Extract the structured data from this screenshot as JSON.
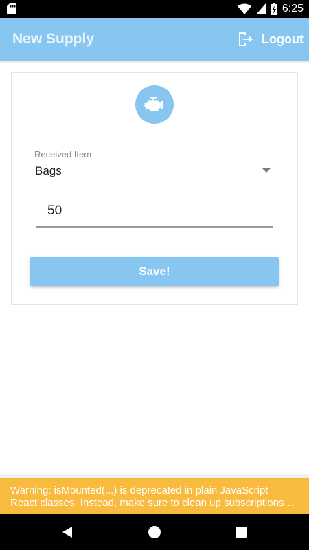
{
  "status_bar": {
    "time": "6:25",
    "icons": [
      "sd-card-icon",
      "wifi-icon",
      "cellular-signal-icon",
      "battery-charging-icon"
    ]
  },
  "app_bar": {
    "title": "New Supply",
    "logout_label": "Logout",
    "logout_icon": "logout-icon",
    "background_color": "#86c6f0"
  },
  "form": {
    "icon": "engine-icon",
    "received_item": {
      "label": "Received Item",
      "selected_value": "Bags"
    },
    "quantity": {
      "value": "50"
    },
    "save_label": "Save!"
  },
  "warning": {
    "line1": "Warning: isMounted(...) is deprecated in plain JavaScript",
    "line2": "React classes. Instead, make sure to clean up subscriptions…",
    "background_color": "#f9bb3f"
  },
  "nav_bar": {
    "buttons": [
      "back-icon",
      "home-icon",
      "recents-icon"
    ]
  }
}
